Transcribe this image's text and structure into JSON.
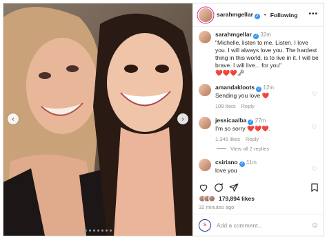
{
  "header": {
    "username": "sarahmgellar",
    "separator": "•",
    "follow_label": "Following",
    "more_icon": "more-icon"
  },
  "caption": {
    "username": "sarahmgellar",
    "time": "32m",
    "text": "\"Michelle, listen to me. Listen. I love you. I will always love you. The hardest thing in this world, is to live in it. I will be brave. I will live... for you\"",
    "emojis": "❤️❤️❤️🗝"
  },
  "comments": [
    {
      "username": "amandakloots",
      "time": "12m",
      "text": "Sending you love ❤️",
      "likes": "108 likes",
      "reply": "Reply"
    },
    {
      "username": "jessicaalba",
      "time": "27m",
      "text": "I'm so sorry ❤️❤️❤️.",
      "likes": "1,346 likes",
      "reply": "Reply",
      "view_replies": "View all 2 replies"
    },
    {
      "username": "csiriano",
      "time": "11m",
      "text": "love you"
    }
  ],
  "post": {
    "likes_count": "179,894 likes",
    "posted": "32 minutes ago"
  },
  "add_comment": {
    "placeholder": "Add a comment..."
  },
  "carousel": {
    "total": 7,
    "active_index": 0,
    "prev_symbol": "‹",
    "next_symbol": "›"
  },
  "colors": {
    "verified": "#3897f0",
    "heart": "#ed4956",
    "muted": "#8e8e8e"
  }
}
